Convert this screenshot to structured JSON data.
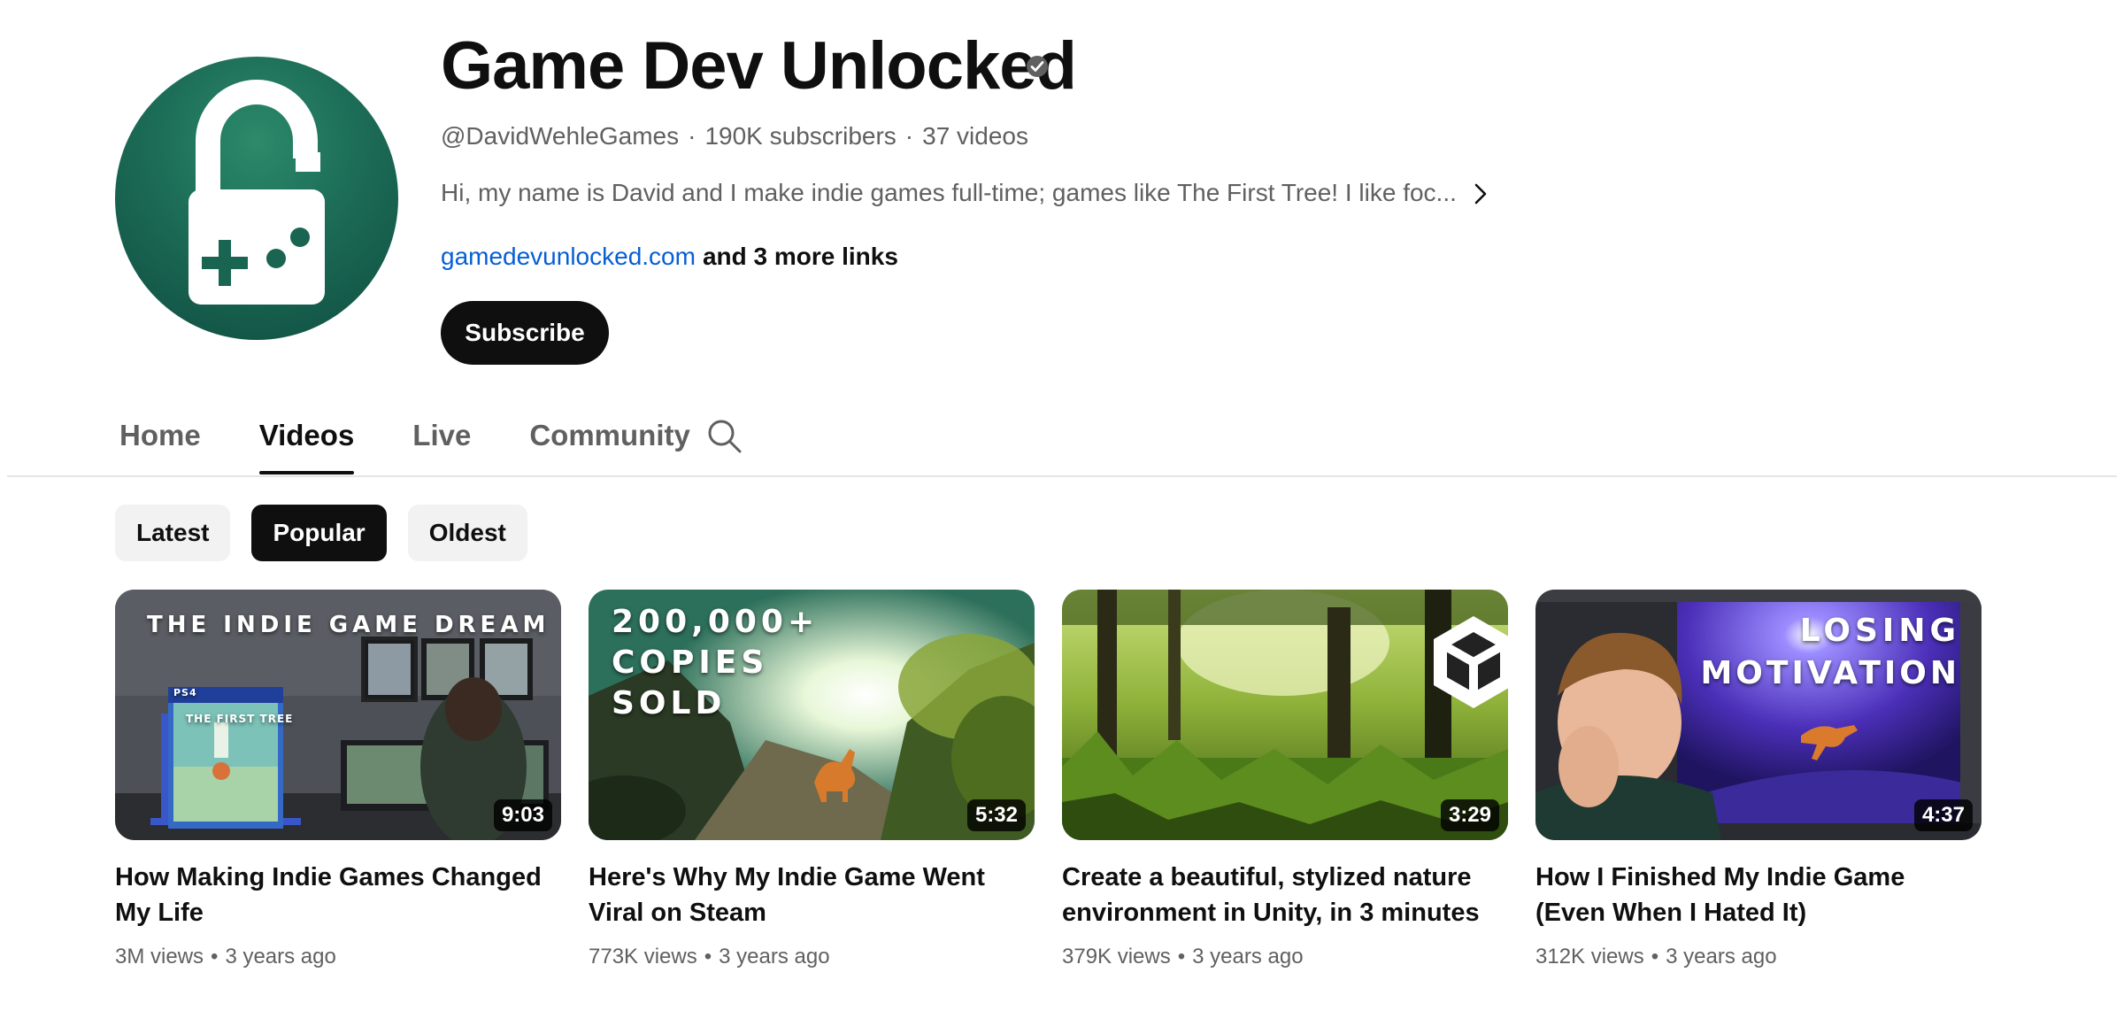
{
  "channel": {
    "name": "Game Dev Unlocked",
    "handle": "@DavidWehleGames",
    "subscribers": "190K subscribers",
    "video_count": "37 videos",
    "description": "Hi, my name is David and I make indie games full-time; games like The First Tree! I like foc...",
    "link_text": "gamedevunlocked.com",
    "more_links": "and 3 more links",
    "subscribe_label": "Subscribe"
  },
  "tabs": [
    {
      "label": "Home",
      "active": false
    },
    {
      "label": "Videos",
      "active": true
    },
    {
      "label": "Live",
      "active": false
    },
    {
      "label": "Community",
      "active": false
    }
  ],
  "chips": [
    {
      "label": "Latest",
      "active": false
    },
    {
      "label": "Popular",
      "active": true
    },
    {
      "label": "Oldest",
      "active": false
    }
  ],
  "videos": [
    {
      "title": "How Making Indie Games Changed My Life",
      "views": "3M views",
      "age": "3 years ago",
      "duration": "9:03",
      "thumb_text": "THE INDIE GAME DREAM",
      "thumb_sub": [
        "PS4",
        "THE FIRST TREE"
      ]
    },
    {
      "title": "Here's Why My Indie Game Went Viral on Steam",
      "views": "773K views",
      "age": "3 years ago",
      "duration": "5:32",
      "thumb_text": [
        "200,000+",
        "COPIES",
        "SOLD"
      ]
    },
    {
      "title": "Create a beautiful, stylized nature environment in Unity, in 3 minutes",
      "views": "379K views",
      "age": "3 years ago",
      "duration": "3:29"
    },
    {
      "title": "How I Finished My Indie Game (Even When I Hated It)",
      "views": "312K views",
      "age": "3 years ago",
      "duration": "4:37",
      "thumb_text": [
        "LOSING",
        "MOTIVATION"
      ]
    }
  ],
  "icons": {
    "verified": "verified-check-icon",
    "description_more": "chevron-right-icon",
    "tab_search": "search-icon"
  },
  "colors": {
    "link": "#065fd4",
    "primary_button": "#0f0f0f",
    "secondary_text": "#606060",
    "avatar_green": "#1d6e58"
  }
}
